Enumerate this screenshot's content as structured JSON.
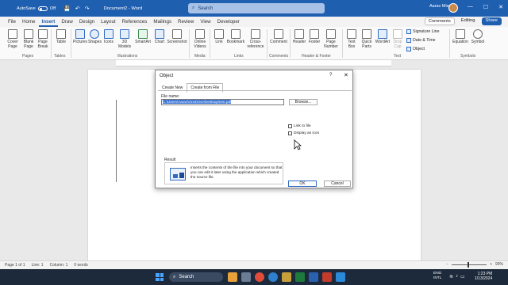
{
  "titlebar": {
    "autosave_label": "AutoSave",
    "autosave_state": "Off",
    "document_name": "Document2 - Word",
    "search_placeholder": "Search",
    "user_name": "Aarav Misra",
    "minimize": "—",
    "maximize": "☐",
    "close": "✕"
  },
  "tabs": [
    "File",
    "Home",
    "Insert",
    "Draw",
    "Design",
    "Layout",
    "References",
    "Mailings",
    "Review",
    "View",
    "Developer"
  ],
  "tab_active": "Insert",
  "tab_actions": {
    "comments": "Comments",
    "editing": "Editing",
    "share": "Share"
  },
  "ribbon": {
    "groups": {
      "pages": "Pages",
      "tables": "Tables",
      "illustrations": "Illustrations",
      "media": "Media",
      "links": "Links",
      "comments": "Comments",
      "header_footer": "Header & Footer",
      "text": "Text",
      "symbols": "Symbols"
    },
    "buttons": {
      "cover_page": "Cover Page",
      "blank_page": "Blank Page",
      "page_break": "Page Break",
      "table": "Table",
      "pictures": "Pictures",
      "shapes": "Shapes",
      "icons": "Icons",
      "3d_models": "3D Models",
      "smartart": "SmartArt",
      "chart": "Chart",
      "screenshot": "Screenshot",
      "online_videos": "Online Videos",
      "link": "Link",
      "bookmark": "Bookmark",
      "cross_reference": "Cross-reference",
      "comment": "Comment",
      "header": "Header",
      "footer": "Footer",
      "page_number": "Page Number",
      "text_box": "Text Box",
      "quick_parts": "Quick Parts",
      "wordart": "WordArt",
      "drop_cap": "Drop Cap",
      "signature_line": "Signature Line",
      "date_time": "Date & Time",
      "object": "Object",
      "equation": "Equation",
      "symbol": "Symbol"
    }
  },
  "dialog": {
    "title": "Object",
    "help": "?",
    "close": "✕",
    "tabs": [
      "Create New",
      "Create from File"
    ],
    "active_tab": "Create from File",
    "file_name_label": "File name:",
    "file_name_value": "C:\\Users\\Aarav\\OneDrive\\Desktop\\test.pdf",
    "browse": "Browse...",
    "link_to_file": "Link to file",
    "display_as_icon": "Display as icon",
    "result_label": "Result",
    "result_text": "Inserts the contents of the file into your document so that you can edit it later using the application which created the source file.",
    "ok": "OK",
    "cancel": "Cancel"
  },
  "statusbar": {
    "page": "Page 1 of 1",
    "line": "Line: 1",
    "column": "Column: 1",
    "words": "0 words",
    "zoom": "90%"
  },
  "taskbar": {
    "search": "Search",
    "lang": "ENG",
    "region": "INTL",
    "time": "1:23 PM",
    "date": "1/13/2024"
  }
}
